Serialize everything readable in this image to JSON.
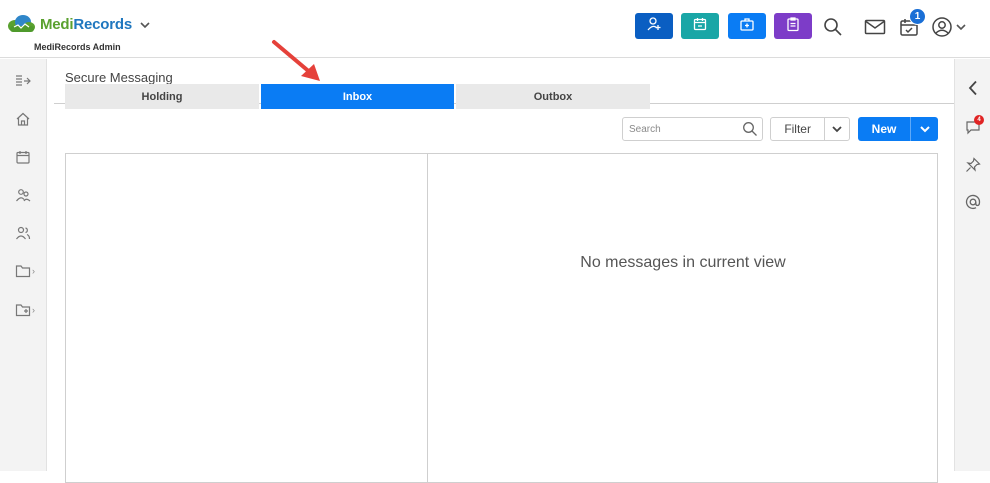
{
  "header": {
    "logo_name_green": "Medi",
    "logo_name_blue": "Records",
    "logo_subtitle": "MediRecords Admin",
    "notification_count": "1",
    "buttons": [
      {
        "icon": "add-person-icon",
        "color": "#0a5ec2"
      },
      {
        "icon": "calendar-icon",
        "color": "#19a6a6"
      },
      {
        "icon": "medical-kit-icon",
        "color": "#0a7cf4"
      },
      {
        "icon": "clipboard-icon",
        "color": "#7d3cc8"
      }
    ]
  },
  "sidebar_left": {
    "items": [
      "expand-icon",
      "home-icon",
      "calendar-icon",
      "patients-icon",
      "users-icon",
      "folder-icon",
      "folder-add-icon"
    ]
  },
  "sidebar_right": {
    "message_badge": "4"
  },
  "page": {
    "title": "Secure Messaging",
    "tabs": [
      {
        "label": "Holding",
        "active": false
      },
      {
        "label": "Inbox",
        "active": true
      },
      {
        "label": "Outbox",
        "active": false
      }
    ],
    "search_placeholder": "Search",
    "filter_label": "Filter",
    "new_label": "New",
    "empty_message": "No messages in current view"
  },
  "colors": {
    "accent": "#0a7cf4",
    "brand_green": "#5aa12f",
    "brand_blue": "#1f77bf",
    "annotation_arrow": "#e5413a"
  }
}
